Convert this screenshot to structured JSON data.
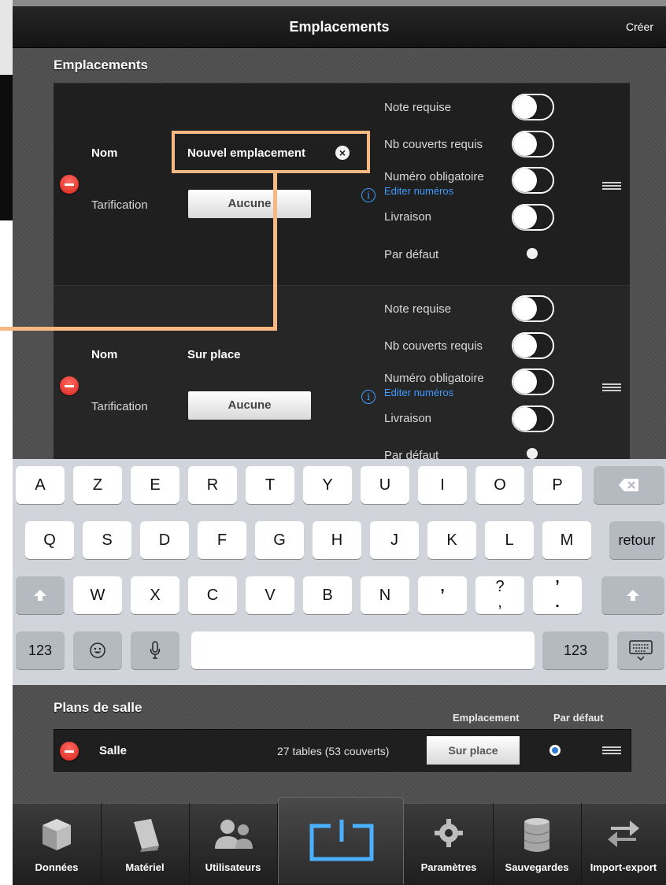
{
  "nav": {
    "title": "Emplacements",
    "create_label": "Créer"
  },
  "section_locations": {
    "title": "Emplacements"
  },
  "locations": [
    {
      "name_label": "Nom",
      "name_value": "Nouvel emplacement",
      "pricing_label": "Tarification",
      "pricing_value": "Aucune",
      "options": {
        "note": "Note requise",
        "covers": "Nb couverts requis",
        "number": "Numéro obligatoire",
        "edit_numbers": "Editer numéros",
        "delivery": "Livraison",
        "default": "Par défaut"
      }
    },
    {
      "name_label": "Nom",
      "name_value": "Sur place",
      "pricing_label": "Tarification",
      "pricing_value": "Aucune",
      "options": {
        "note": "Note requise",
        "covers": "Nb couverts requis",
        "number": "Numéro obligatoire",
        "edit_numbers": "Editer numéros",
        "delivery": "Livraison",
        "default": "Par défaut"
      }
    }
  ],
  "keyboard": {
    "row1": [
      "A",
      "Z",
      "E",
      "R",
      "T",
      "Y",
      "U",
      "I",
      "O",
      "P"
    ],
    "row2": [
      "Q",
      "S",
      "D",
      "F",
      "G",
      "H",
      "J",
      "K",
      "L",
      "M"
    ],
    "row2_return": "retour",
    "row3": [
      "W",
      "X",
      "C",
      "V",
      "B",
      "N"
    ],
    "row3_punct": [
      "’",
      "?\n,",
      "’\n."
    ],
    "row4_left": "123",
    "row4_right": "123"
  },
  "plans": {
    "title": "Plans de salle",
    "col_location": "Emplacement",
    "col_default": "Par défaut",
    "row": {
      "name": "Salle",
      "tables": "27 tables (53 couverts)",
      "location": "Sur place"
    }
  },
  "tabs": [
    {
      "label": "Données",
      "icon": "box-icon"
    },
    {
      "label": "Matériel",
      "icon": "device-icon"
    },
    {
      "label": "Utilisateurs",
      "icon": "users-icon"
    },
    {
      "label": "",
      "icon": "power-icon"
    },
    {
      "label": "Paramètres",
      "icon": "gear-icon"
    },
    {
      "label": "Sauvegardes",
      "icon": "database-icon"
    },
    {
      "label": "Import-export",
      "icon": "arrows-icon"
    }
  ],
  "colors": {
    "accent": "#f7b882",
    "link": "#3e9bff",
    "delete": "#e0322a"
  }
}
